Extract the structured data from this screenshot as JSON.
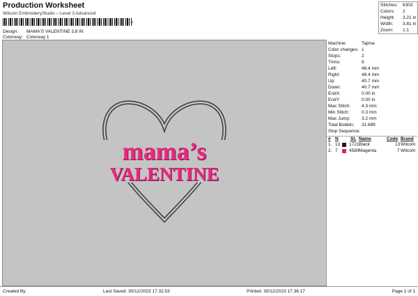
{
  "header": {
    "title": "Production Worksheet",
    "subtitle": "Wilcom EmbroideryStudio – Level 3 Advanced",
    "barcode_mark": "’"
  },
  "design": {
    "label": "Design:",
    "value": "MAMA'S VALENTINE 3,8 IN"
  },
  "colorway": {
    "label": "Colorway:",
    "value": "Colorway 1"
  },
  "stats": [
    {
      "label": "Stitches:",
      "value": "6303"
    },
    {
      "label": "Colors:",
      "value": "2"
    },
    {
      "label": "Height:",
      "value": "3.21 in"
    },
    {
      "label": "Width:",
      "value": "3.81 in"
    },
    {
      "label": "Zoom:",
      "value": "1:1"
    }
  ],
  "machine_info": [
    {
      "label": "Machine:",
      "value": "Tajima"
    },
    {
      "label": "Color changes:",
      "value": "1"
    },
    {
      "label": "Stops:",
      "value": "2"
    },
    {
      "label": "Trims:",
      "value": "9"
    },
    {
      "label": "Left:",
      "value": "48.4 mm"
    },
    {
      "label": "Right:",
      "value": "48.4 mm"
    },
    {
      "label": "Up:",
      "value": "40.7 mm"
    },
    {
      "label": "Down:",
      "value": "40.7 mm"
    },
    {
      "label": "EndX:",
      "value": "0.00 in"
    },
    {
      "label": "EndY:",
      "value": "0.00 in"
    },
    {
      "label": "Max Stitch:",
      "value": "4.3 mm"
    },
    {
      "label": "Min Stitch:",
      "value": "0.3 mm"
    },
    {
      "label": "Max Jump:",
      "value": "3.2 mm"
    },
    {
      "label": "Total Bobbin:",
      "value": "31.68ft"
    }
  ],
  "stop_sequence": {
    "title": "Stop Sequence:",
    "headers": {
      "num": "#",
      "n": "N",
      "st": "St.",
      "name": "Name",
      "code": "Code",
      "brand": "Brand"
    },
    "rows": [
      {
        "num": "1.",
        "n": "13",
        "color": "#1a1a1a",
        "st": "1721",
        "name": "Black",
        "code": "13",
        "brand": "Wilcom"
      },
      {
        "num": "2.",
        "n": "7",
        "color": "#e0217a",
        "st": "4580",
        "name": "Magenta",
        "code": "7",
        "brand": "Wilcom"
      }
    ]
  },
  "artwork": {
    "line1": "mama’s",
    "line2": "VALENTINE",
    "heart_color": "#3a3a3a",
    "text_color": "#e8287f"
  },
  "footer": {
    "created_by": "Created By:",
    "last_saved": "Last Saved: 30/12/2023 17.32.53",
    "printed": "Printed: 30/12/2023 17.36.17",
    "page": "Page 1 of 1"
  }
}
